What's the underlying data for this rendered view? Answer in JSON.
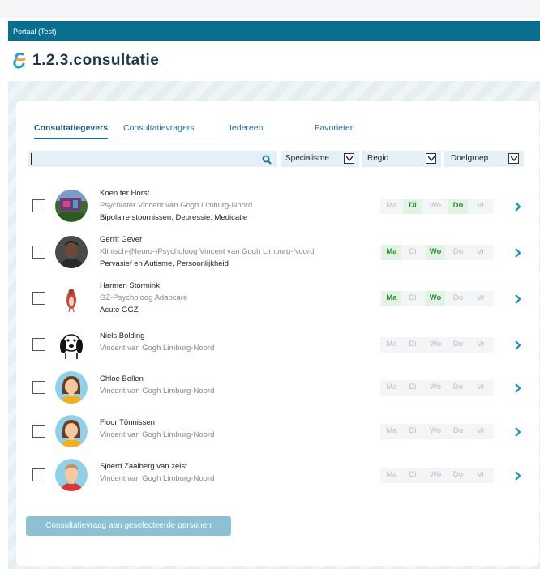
{
  "portal": {
    "title": "Portaal (Test)"
  },
  "logo": {
    "prefix": "1.2.3.",
    "name": "consultatie",
    "icon": "ampersand-logo-icon"
  },
  "tabs": [
    {
      "label": "Consultatiegevers",
      "active": true
    },
    {
      "label": "Consultatievragers",
      "active": false
    },
    {
      "label": "Iedereen",
      "active": false
    },
    {
      "label": "Favorieten",
      "active": false
    }
  ],
  "search": {
    "value": "",
    "placeholder": "",
    "icon": "search-icon"
  },
  "filters": [
    {
      "label": "Specialisme"
    },
    {
      "label": "Regio"
    },
    {
      "label": "Doelgroep"
    }
  ],
  "day_labels": [
    "Ma",
    "Di",
    "Wo",
    "Do",
    "Vr"
  ],
  "people": [
    {
      "name": "Koen ter Horst",
      "role": "Psychiater Vincent van Gogh Limburg-Noord",
      "specialism": "Bipolaire stoornissen, Depressie, Medicatie",
      "avatar": "photo-garden",
      "available": [
        false,
        true,
        false,
        true,
        false
      ]
    },
    {
      "name": "Gerrit Gever",
      "role": "Klinisch-(Neuro-)Psycholoog Vincent van Gogh Limburg-Noord",
      "specialism": "Pervasief en Autisme, Persoonlijkheid",
      "avatar": "photo-man",
      "available": [
        true,
        false,
        true,
        false,
        false
      ]
    },
    {
      "name": "Harmen Stormink",
      "role": "GZ-Psycholoog Adapcare",
      "specialism": "Acute GGZ",
      "avatar": "photo-bird",
      "available": [
        true,
        false,
        true,
        false,
        false
      ]
    },
    {
      "name": "Niels Bolding",
      "role": "Vincent van Gogh Limburg-Noord",
      "specialism": "",
      "avatar": "cartoon-dog",
      "available": [
        false,
        false,
        false,
        false,
        false
      ]
    },
    {
      "name": "Chloe Bollen",
      "role": "Vincent van Gogh Limburg-Noord",
      "specialism": "",
      "avatar": "avatar-woman",
      "available": [
        false,
        false,
        false,
        false,
        false
      ]
    },
    {
      "name": "Floor Tönnissen",
      "role": "Vincent van Gogh Limburg-Noord",
      "specialism": "",
      "avatar": "avatar-woman",
      "available": [
        false,
        false,
        false,
        false,
        false
      ]
    },
    {
      "name": "Sjoerd Zaalberg van zelst",
      "role": "Vincent van Gogh Limburg-Noord",
      "specialism": "",
      "avatar": "avatar-man",
      "available": [
        false,
        false,
        false,
        false,
        false
      ]
    }
  ],
  "cta": {
    "label": "Consultatievraag aan geselecteerde personen"
  },
  "colors": {
    "brand": "#0a6e8f",
    "link": "#1a6f97",
    "available": "#2d8a3c",
    "cta": "#8cc0d3"
  }
}
